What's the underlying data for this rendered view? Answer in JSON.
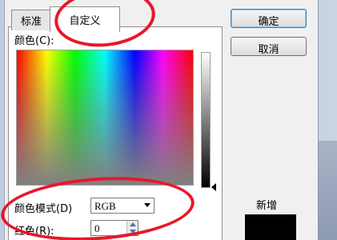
{
  "tabs": [
    {
      "label": "标准",
      "active": false
    },
    {
      "label": "自定义",
      "active": true
    }
  ],
  "colors_label": "颜色(C):",
  "color_model_label": "颜色模式(D)",
  "color_model_value": "RGB",
  "red_label": "红色(R):",
  "red_value": "0",
  "buttons": {
    "ok": "确定",
    "cancel": "取消"
  },
  "new_label": "新增",
  "new_color": "#000000",
  "annotation_color": "#e8172a"
}
